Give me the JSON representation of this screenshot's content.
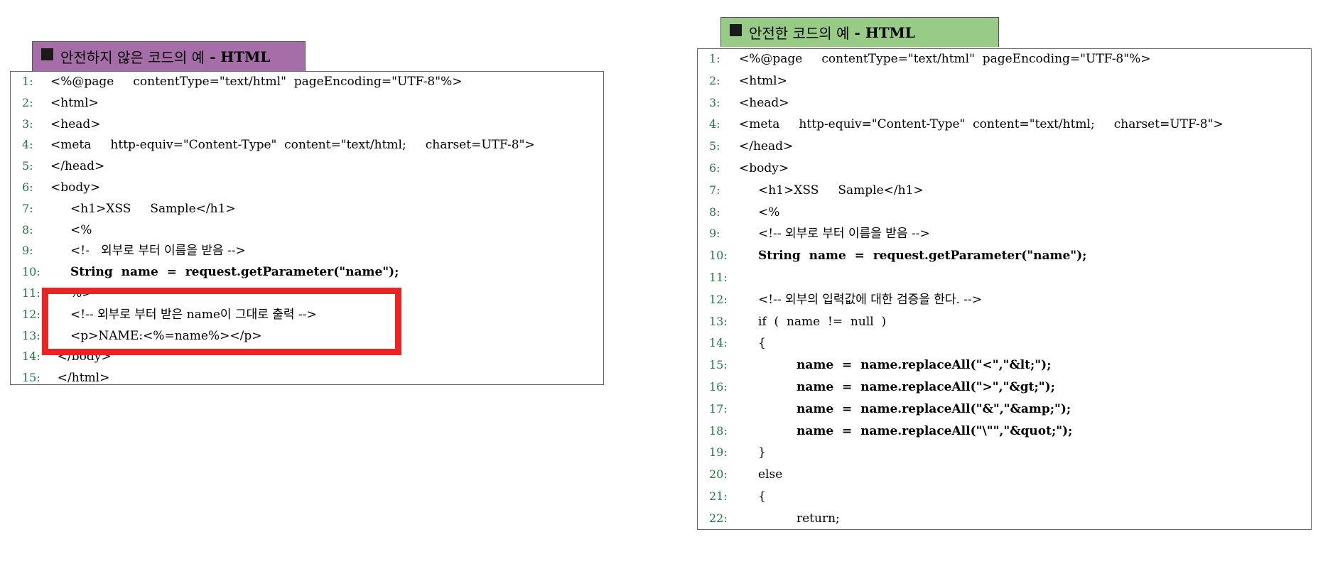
{
  "left_panel": {
    "title_text": "안전하지 않은 코드의 예",
    "title_dash": "-",
    "title_lang": "HTML",
    "lines": [
      {
        "num": "1:",
        "text": "<%@page     contentType=\"text/html\"  pageEncoding=\"UTF-8\"%>",
        "indent": 0,
        "bold": false
      },
      {
        "num": "2:",
        "text": "<html>",
        "indent": 0,
        "bold": false
      },
      {
        "num": "3:",
        "text": "<head>",
        "indent": 0,
        "bold": false
      },
      {
        "num": "4:",
        "text": "<meta     http-equiv=\"Content-Type\"  content=\"text/html;     charset=UTF-8\">",
        "indent": 0,
        "bold": false
      },
      {
        "num": "5:",
        "text": "</head>",
        "indent": 0,
        "bold": false
      },
      {
        "num": "6:",
        "text": "<body>",
        "indent": 0,
        "bold": false
      },
      {
        "num": "7:",
        "text": "<h1>XSS     Sample</h1>",
        "indent": 1,
        "bold": false
      },
      {
        "num": "8:",
        "text": "<%",
        "indent": 1,
        "bold": false
      },
      {
        "num": "9:",
        "text": "<!-   외부로 부터 이름을 받음 -->",
        "indent": 1,
        "bold": false
      },
      {
        "num": "10:",
        "text": "String  name  =  request.getParameter(\"name\");",
        "indent": 1,
        "bold": true
      },
      {
        "num": "11:",
        "text": "%>",
        "indent": 1,
        "bold": false
      },
      {
        "num": "12:",
        "text": "<!-- 외부로 부터 받은 name이 그대로 출력 -->",
        "indent": 1,
        "bold": false
      },
      {
        "num": "13:",
        "text": "<p>NAME:<%=name%></p>",
        "indent": 1,
        "bold": false
      },
      {
        "num": "14:",
        "text": "</body>",
        "indent": 0.35,
        "bold": false
      },
      {
        "num": "15:",
        "text": "</html>",
        "indent": 0.35,
        "bold": false
      }
    ]
  },
  "right_panel": {
    "title_text": "안전한 코드의 예",
    "title_dash": "-",
    "title_lang": "HTML",
    "lines": [
      {
        "num": "1:",
        "text": "<%@page     contentType=\"text/html\"  pageEncoding=\"UTF-8\"%>",
        "indent": 0,
        "bold": false
      },
      {
        "num": "2:",
        "text": "<html>",
        "indent": 0,
        "bold": false
      },
      {
        "num": "3:",
        "text": "<head>",
        "indent": 0,
        "bold": false
      },
      {
        "num": "4:",
        "text": "<meta     http-equiv=\"Content-Type\"  content=\"text/html;     charset=UTF-8\">",
        "indent": 0,
        "bold": false
      },
      {
        "num": "5:",
        "text": "</head>",
        "indent": 0,
        "bold": false
      },
      {
        "num": "6:",
        "text": "<body>",
        "indent": 0,
        "bold": false
      },
      {
        "num": "7:",
        "text": "<h1>XSS     Sample</h1>",
        "indent": 1,
        "bold": false
      },
      {
        "num": "8:",
        "text": "<%",
        "indent": 1,
        "bold": false
      },
      {
        "num": "9:",
        "text": "<!-- 외부로 부터 이름을 받음 -->",
        "indent": 1,
        "bold": false
      },
      {
        "num": "10:",
        "text": "String  name  =  request.getParameter(\"name\");",
        "indent": 1,
        "bold": true
      },
      {
        "num": "11:",
        "text": "",
        "indent": 1,
        "bold": false
      },
      {
        "num": "12:",
        "text": "<!-- 외부의 입력값에 대한 검증을 한다. -->",
        "indent": 1,
        "bold": false
      },
      {
        "num": "13:",
        "text": "if  (  name  !=  null  )",
        "indent": 1,
        "bold": false
      },
      {
        "num": "14:",
        "text": "{",
        "indent": 1,
        "bold": false
      },
      {
        "num": "15:",
        "text": "name  =  name.replaceAll(\"<\",\"&lt;\");",
        "indent": 3,
        "bold": true
      },
      {
        "num": "16:",
        "text": "name  =  name.replaceAll(\">\",\"&gt;\");",
        "indent": 3,
        "bold": true
      },
      {
        "num": "17:",
        "text": "name  =  name.replaceAll(\"&\",\"&amp;\");",
        "indent": 3,
        "bold": true
      },
      {
        "num": "18:",
        "text": "name  =  name.replaceAll(\"\\\"\",\"&quot;\");",
        "indent": 3,
        "bold": true
      },
      {
        "num": "19:",
        "text": "}",
        "indent": 1,
        "bold": false
      },
      {
        "num": "20:",
        "text": "else",
        "indent": 1,
        "bold": false
      },
      {
        "num": "21:",
        "text": "{",
        "indent": 1,
        "bold": false
      },
      {
        "num": "22:",
        "text": "return;",
        "indent": 3,
        "bold": false
      }
    ]
  },
  "colors": {
    "left_title_bg": "#a66ea8",
    "right_title_bg": "#98cc86",
    "line_number": "#1e7a3c",
    "highlight_border": "#ee2222"
  }
}
